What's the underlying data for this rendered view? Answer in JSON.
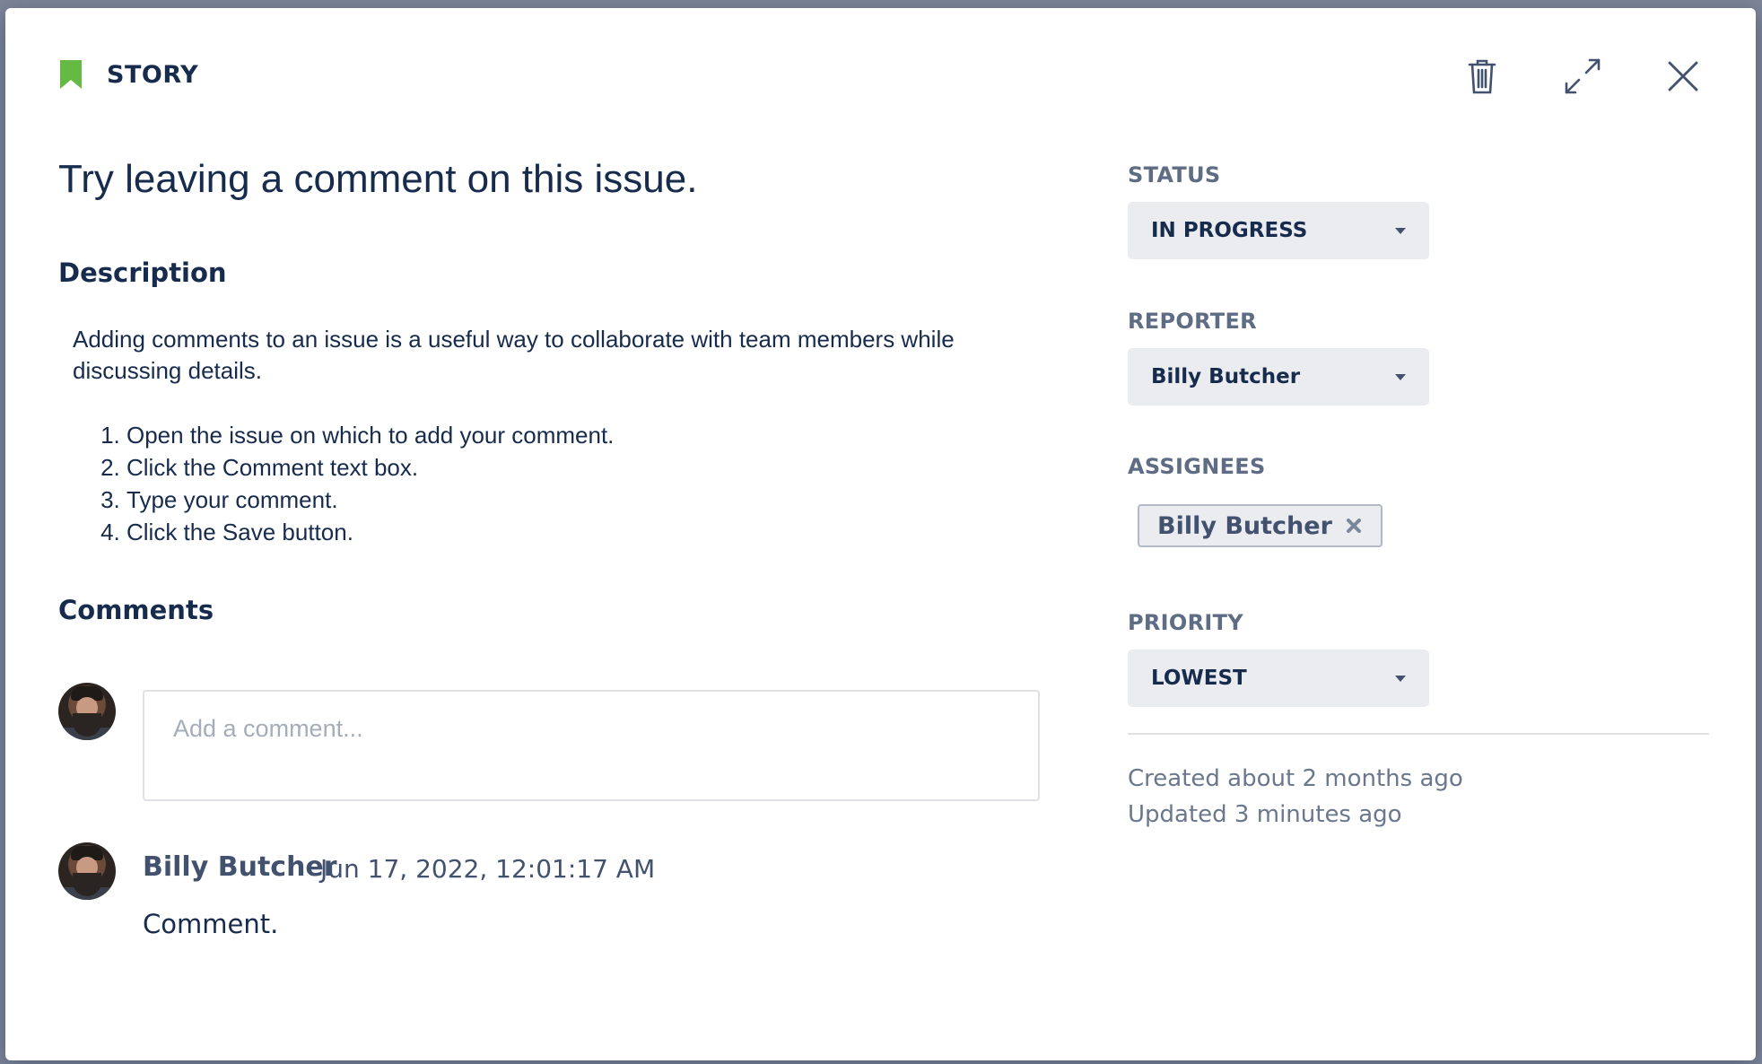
{
  "header": {
    "issue_type": "STORY",
    "icons": {
      "type": "bookmark-icon",
      "delete": "trash-icon",
      "expand": "expand-icon",
      "close": "close-icon"
    }
  },
  "issue": {
    "title": "Try leaving a comment on this issue.",
    "description_heading": "Description",
    "description_text": "Adding comments to an issue is a useful way to collaborate with team members while discussing details.",
    "steps": [
      "Open the issue on which to add your comment.",
      "Click the Comment text box.",
      "Type your comment.",
      "Click the Save button."
    ]
  },
  "comments": {
    "heading": "Comments",
    "input_placeholder": "Add a comment...",
    "items": [
      {
        "author": "Billy Butcher",
        "date": "Jun 17, 2022, 12:01:17 AM",
        "body": "Comment."
      }
    ]
  },
  "sidebar": {
    "status_label": "STATUS",
    "status_value": "IN PROGRESS",
    "reporter_label": "REPORTER",
    "reporter_value": "Billy Butcher",
    "assignees_label": "ASSIGNEES",
    "assignees": [
      "Billy Butcher"
    ],
    "priority_label": "PRIORITY",
    "priority_value": "LOWEST",
    "created": "Created about 2 months ago",
    "updated": "Updated 3 minutes ago"
  },
  "colors": {
    "story_green": "#65ba43",
    "text_primary": "#172b4d",
    "text_secondary": "#5e6c84",
    "select_bg": "#ebecf0"
  }
}
